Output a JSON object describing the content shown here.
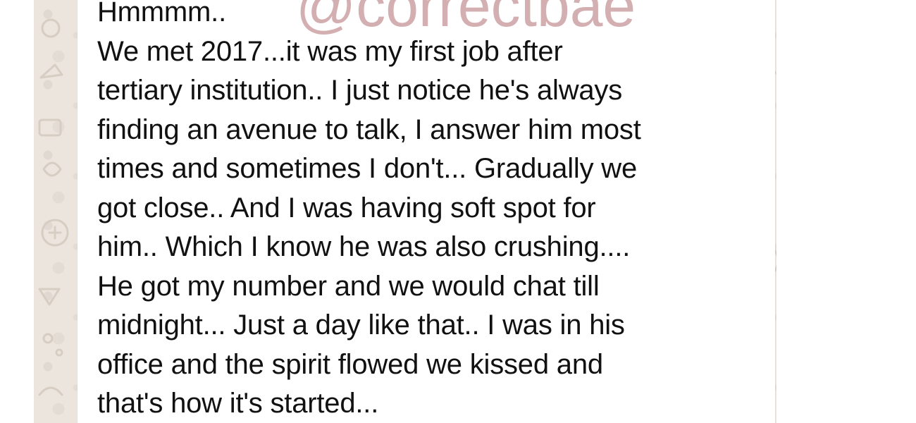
{
  "watermark": {
    "text": "@correctbae"
  },
  "message": {
    "text": "Hmmmm..\nWe met 2017...it was my first job after\ntertiary institution.. I just notice he's always\nfinding an avenue to talk, I answer him most\ntimes and sometimes I don't... Gradually we\ngot close.. And I was having soft spot for\nhim.. Which I know he was also crushing....\nHe got my number and we would chat till\nmidnight... Just a day like that.. I was in his\noffice and the spirit flowed we kissed and\nthat's how it's started..."
  },
  "colors": {
    "wallpaper": "#ece5dd",
    "bubble": "#ffffff",
    "text": "#111111",
    "watermark": "#cfa4a7",
    "margin": "#ffffff"
  }
}
